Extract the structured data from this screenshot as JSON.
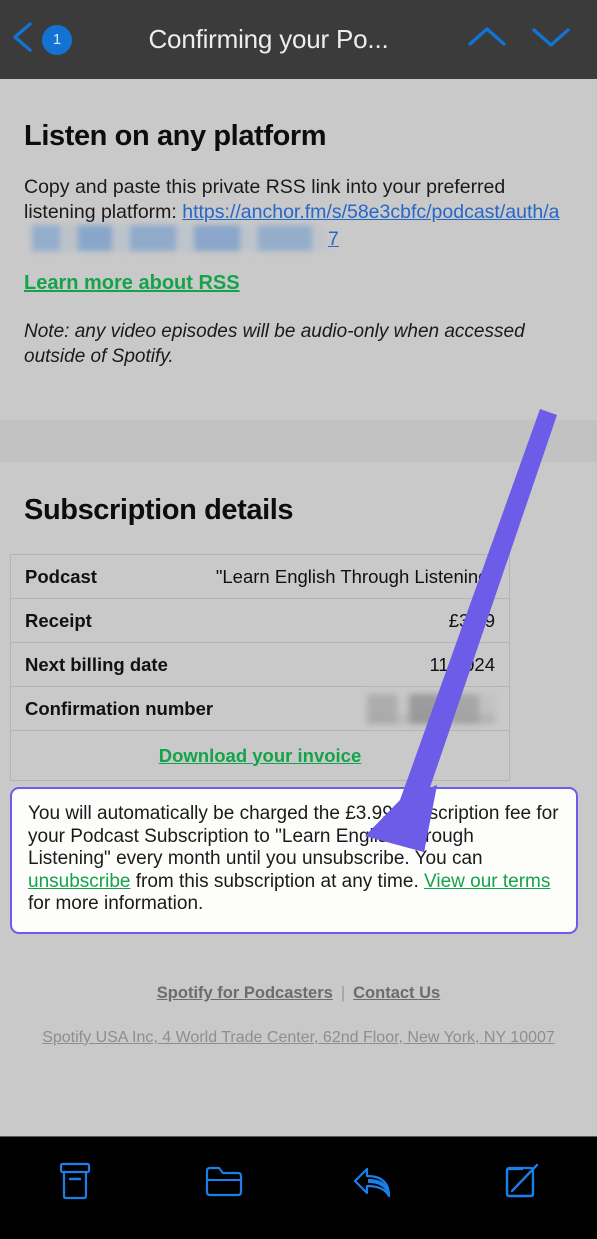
{
  "navbar": {
    "back_icon": "chevron-left-icon",
    "unread_count": "1",
    "title": "Confirming your Po...",
    "up_icon": "chevron-up-icon",
    "down_icon": "chevron-down-icon",
    "background": "#3b3b3b",
    "accent": "#1273d4"
  },
  "rss": {
    "heading": "Listen on any platform",
    "body_prefix": "Copy and paste this private RSS link into your preferred listening platform: ",
    "url_visible_start": "https://anchor.fm/s/58e3cbfc/podcast/auth/a",
    "url_redacted": "[redacted]",
    "url_visible_end": "7",
    "learn_more_label": "Learn more about RSS",
    "note": "Note: any video episodes will be audio-only when accessed outside of Spotify."
  },
  "subscription": {
    "heading": "Subscription details",
    "rows": [
      {
        "label": "Podcast",
        "value": "\"Learn English Through Listening\""
      },
      {
        "label": "Receipt",
        "value": "£3.99"
      },
      {
        "label": "Next billing date",
        "value": "11/2024"
      },
      {
        "label": "Confirmation number",
        "value": "[redacted]"
      }
    ],
    "invoice_link": "Download your invoice"
  },
  "disclaimer": {
    "part1": "You will automatically be charged the £3.99 subscription fee for your Podcast Subscription to \"Learn English Through Listening\" every month until you unsubscribe. You can ",
    "unsubscribe_label": "unsubscribe",
    "part2": " from this subscription at any time. ",
    "terms_label": "View our terms",
    "part3": " for more information.",
    "border_color": "#6c5ce7"
  },
  "footer": {
    "link1": "Spotify for Podcasters",
    "separator": "|",
    "link2": "Contact Us",
    "address": "Spotify USA Inc, 4 World Trade Center, 62nd Floor, New York, NY 10007"
  },
  "toolbar": {
    "items": [
      {
        "icon": "archive-icon"
      },
      {
        "icon": "folder-icon"
      },
      {
        "icon": "reply-icon"
      },
      {
        "icon": "compose-icon"
      }
    ],
    "background": "#000000",
    "accent": "#1a7fe8"
  },
  "annotation": {
    "arrow_color": "#6c5ce7",
    "points_to": "unsubscribe"
  },
  "colors": {
    "page_background": "#c9c9c9",
    "link_green": "#14a34a",
    "link_blue": "#2667c9"
  }
}
